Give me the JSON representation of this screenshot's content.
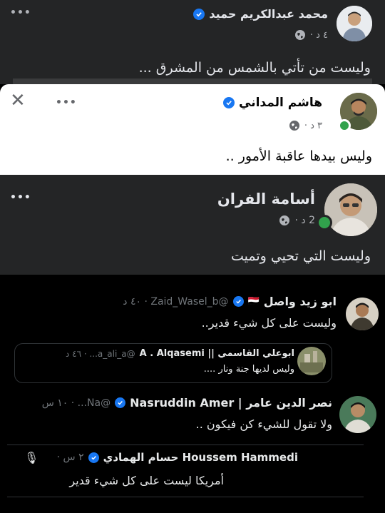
{
  "post1": {
    "author": "محمد عبدالكريم حميد",
    "time": "٤ د ·",
    "text": "وليست من تأتي بالشمس من المشرق ...",
    "more": "•••"
  },
  "post2": {
    "author": "هاشم المداني",
    "time": "٣ د ·",
    "text": "وليس بيدها عاقبة الأمور ..",
    "more": "•••",
    "close": "✕"
  },
  "post3": {
    "author": "أسامة الفران",
    "time": "2 د ·",
    "text": "وليست التي تحيي وتميت",
    "more": "•••"
  },
  "tweets": [
    {
      "name": "ابو زيد واصل",
      "flag": "🇾🇪",
      "handle": "@Zaid_Wasel_b · ٤٠ د",
      "text": "وليست على كل شيء قدير.."
    },
    {
      "name": "ابوعلي القاسمي || A . Alqasemi",
      "handle": "@a_ali_a... · ٤٦ د",
      "text": "وليس لديها جنة ونار ...."
    },
    {
      "name": "نصر الدين عامر | Nasruddin Amer",
      "handle": "@Na... · ١٠ س",
      "text": "ولا تقول للشيء كن فيكون .."
    },
    {
      "name": "Houssem Hammedi حسام الهمادي",
      "handle": "٢ س ·",
      "text": "أمريكا ليست على كل شيء قدير"
    }
  ],
  "colors": {
    "dark_card": "#242526",
    "light_card": "#ffffff",
    "verified": "#1877f2",
    "online": "#31a24c",
    "twitter_bg": "#000000",
    "twitter_muted": "#71767b"
  }
}
